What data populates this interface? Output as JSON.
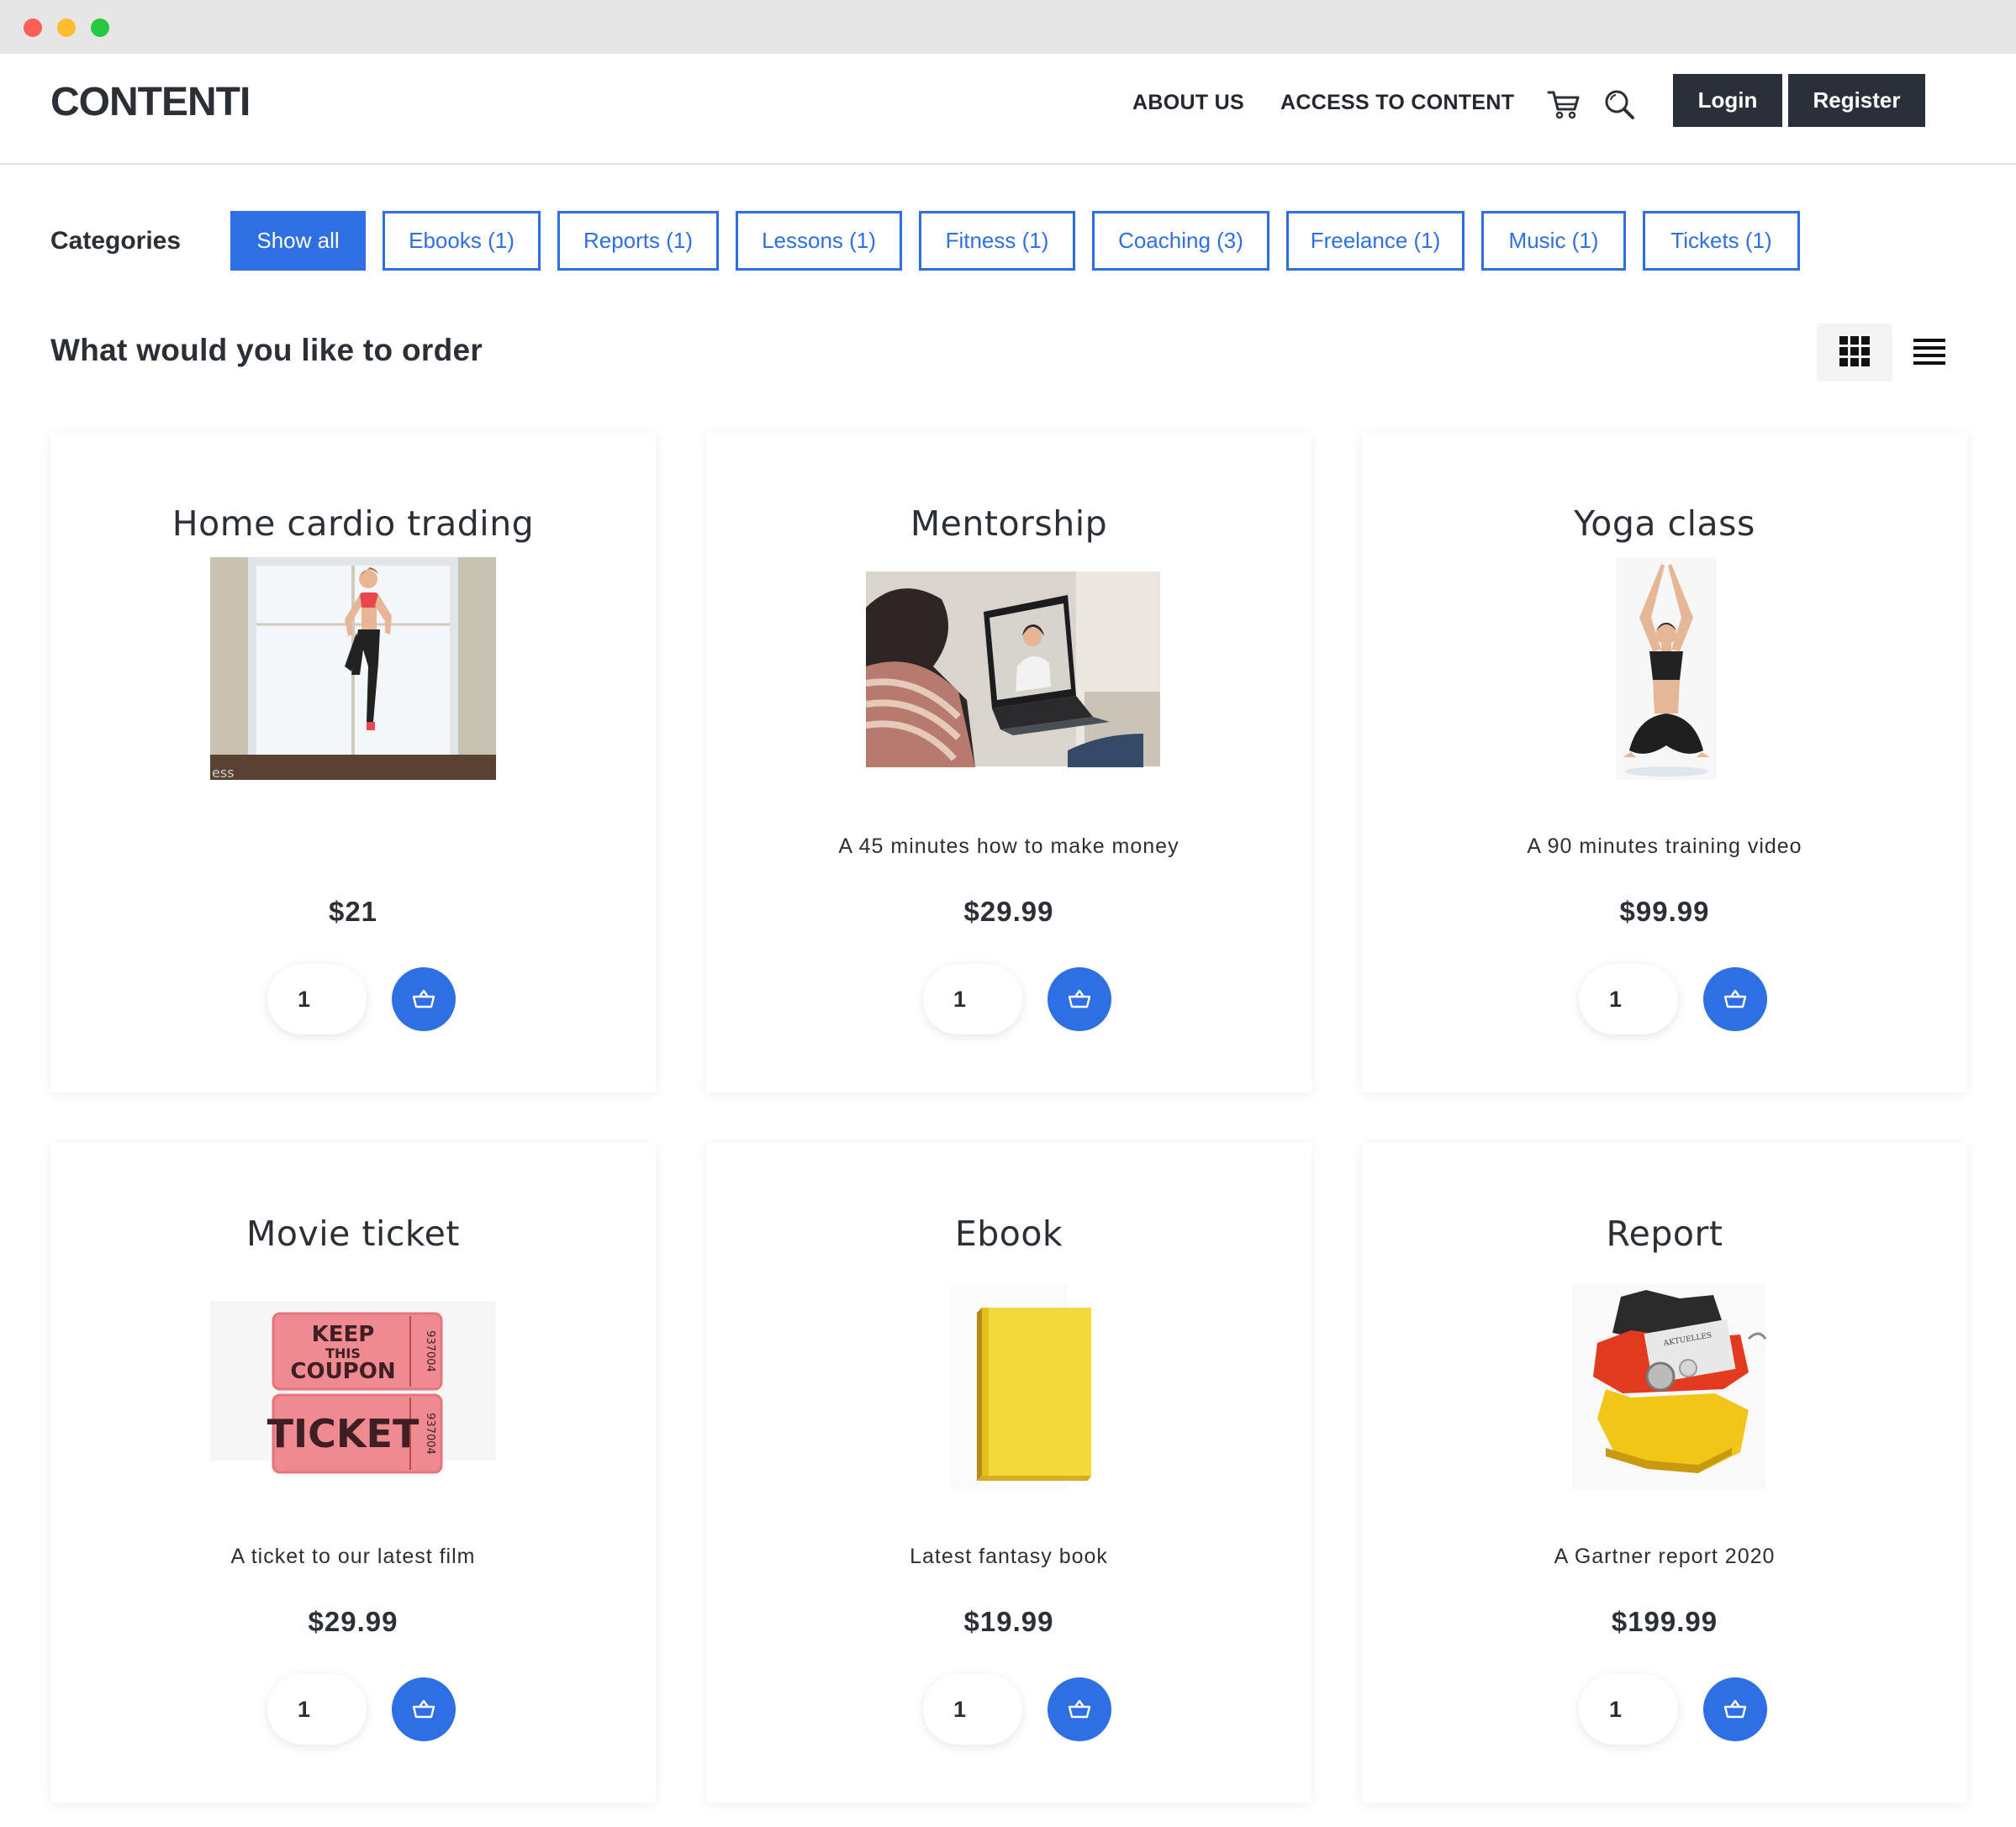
{
  "header": {
    "logo": "CONTENTI",
    "nav": [
      "ABOUT US",
      "ACCESS TO CONTENT"
    ],
    "login": "Login",
    "register": "Register"
  },
  "categories": {
    "label": "Categories",
    "items": [
      "Show all",
      "Ebooks (1)",
      "Reports (1)",
      "Lessons (1)",
      "Fitness (1)",
      "Coaching (3)",
      "Freelance (1)",
      "Music (1)",
      "Tickets (1)"
    ],
    "active": "Show all"
  },
  "section_title": "What would you like to order",
  "colors": {
    "accent": "#2f6fe4",
    "dark": "#2b2f3a",
    "text": "#2b2f36"
  },
  "products": [
    {
      "title": "Home cardio trading",
      "image": "fitness-photo",
      "description": "",
      "price": "$21",
      "qty": "1"
    },
    {
      "title": "Mentorship",
      "image": "video-call-photo",
      "description": "A 45 minutes how to make money",
      "price": "$29.99",
      "qty": "1"
    },
    {
      "title": "Yoga class",
      "image": "yoga-photo",
      "description": "A 90 minutes training video",
      "price": "$99.99",
      "qty": "1"
    },
    {
      "title": "Movie ticket",
      "image": "ticket-photo",
      "description": "A ticket to our latest film",
      "price": "$29.99",
      "qty": "1"
    },
    {
      "title": "Ebook",
      "image": "book-photo",
      "description": "Latest fantasy book",
      "price": "$19.99",
      "qty": "1"
    },
    {
      "title": "Report",
      "image": "germany-map-photo",
      "description": "A Gartner report 2020",
      "price": "$199.99",
      "qty": "1"
    }
  ],
  "image_text": {
    "ticket_top_1": "KEEP",
    "ticket_top_2": "THIS",
    "ticket_top_3": "COUPON",
    "ticket_bottom": "TICKET",
    "ticket_serial": "937004",
    "fitness_watermark": "ess",
    "report_paper": "AKTUELLES"
  }
}
